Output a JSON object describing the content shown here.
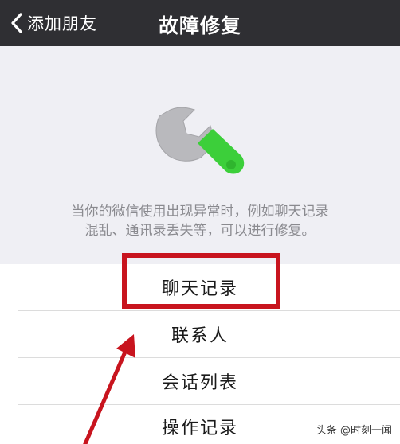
{
  "navbar": {
    "back_label": "添加朋友",
    "title": "故障修复",
    "background": "#2f2f33"
  },
  "hero": {
    "icon": "wrench-icon",
    "description_line1": "当你的微信使用出现异常时，例如聊天记录",
    "description_line2": "混乱、通讯录丢失等，可以进行修复。"
  },
  "menu": {
    "items": [
      {
        "label": "聊天记录"
      },
      {
        "label": "联系人"
      },
      {
        "label": "会话列表"
      },
      {
        "label": "操作记录"
      }
    ]
  },
  "annotations": {
    "highlight_color": "#c8141e",
    "arrow_color": "#c8141e"
  },
  "watermark": "头条 @时刻一闻"
}
